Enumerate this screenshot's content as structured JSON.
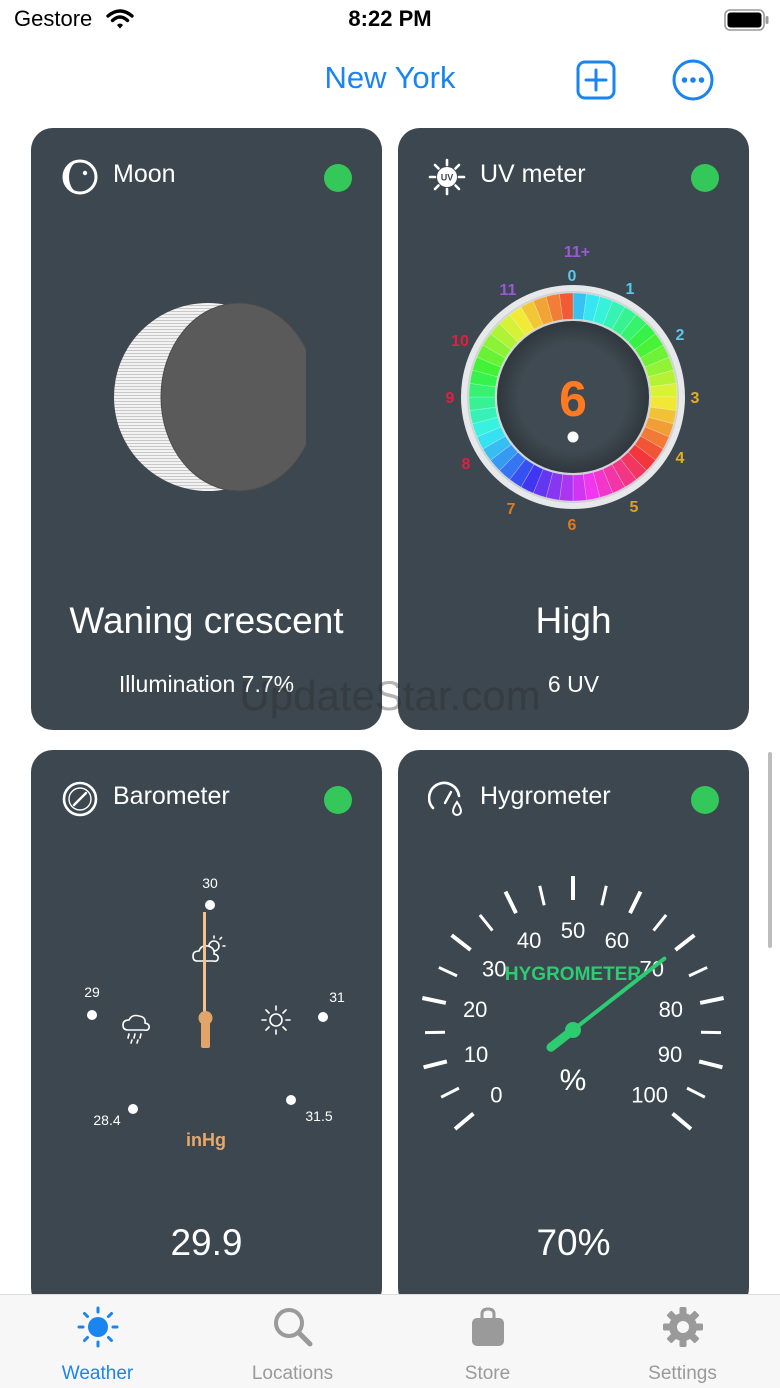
{
  "status_bar": {
    "carrier": "Gestore",
    "time": "8:22 PM"
  },
  "nav": {
    "title": "New York",
    "add_icon": "plus-square-icon",
    "more_icon": "ellipsis-circle-icon"
  },
  "colors": {
    "accent": "#1a84f0",
    "card": "#3c4750",
    "status_dot": "#34c759",
    "hygrometer_green": "#2ecc71",
    "baro_needle": "#e0a567"
  },
  "cards": {
    "moon": {
      "title": "Moon",
      "icon": "moon-icon",
      "phase": "Waning crescent",
      "illumination": "Illumination 7.7%"
    },
    "uv": {
      "title": "UV meter",
      "icon": "uv-sun-icon",
      "value": "6",
      "level": "High",
      "reading": "6 UV",
      "dial_labels": [
        "11+",
        "0",
        "1",
        "2",
        "3",
        "4",
        "5",
        "6",
        "7",
        "8",
        "9",
        "10",
        "11"
      ]
    },
    "barometer": {
      "title": "Barometer",
      "icon": "compass-gauge-icon",
      "value": "29.9",
      "unit": "inHg",
      "scale": {
        "top": "30",
        "left": "29",
        "right": "31",
        "bottom_left": "28.4",
        "bottom_right": "31.5"
      }
    },
    "hygrometer": {
      "title": "Hygrometer",
      "icon": "humidity-gauge-icon",
      "value": "70%",
      "dial_caption": "HYGROMETER",
      "unit": "%",
      "needle_percent": 70,
      "dial_labels": [
        "0",
        "10",
        "20",
        "30",
        "40",
        "50",
        "60",
        "70",
        "80",
        "90",
        "100"
      ]
    }
  },
  "watermark": "UpdateStar.com",
  "tabs": [
    {
      "label": "Weather",
      "icon": "sun-icon",
      "active": true
    },
    {
      "label": "Locations",
      "icon": "search-icon",
      "active": false
    },
    {
      "label": "Store",
      "icon": "shopping-bag-icon",
      "active": false
    },
    {
      "label": "Settings",
      "icon": "gear-icon",
      "active": false
    }
  ]
}
